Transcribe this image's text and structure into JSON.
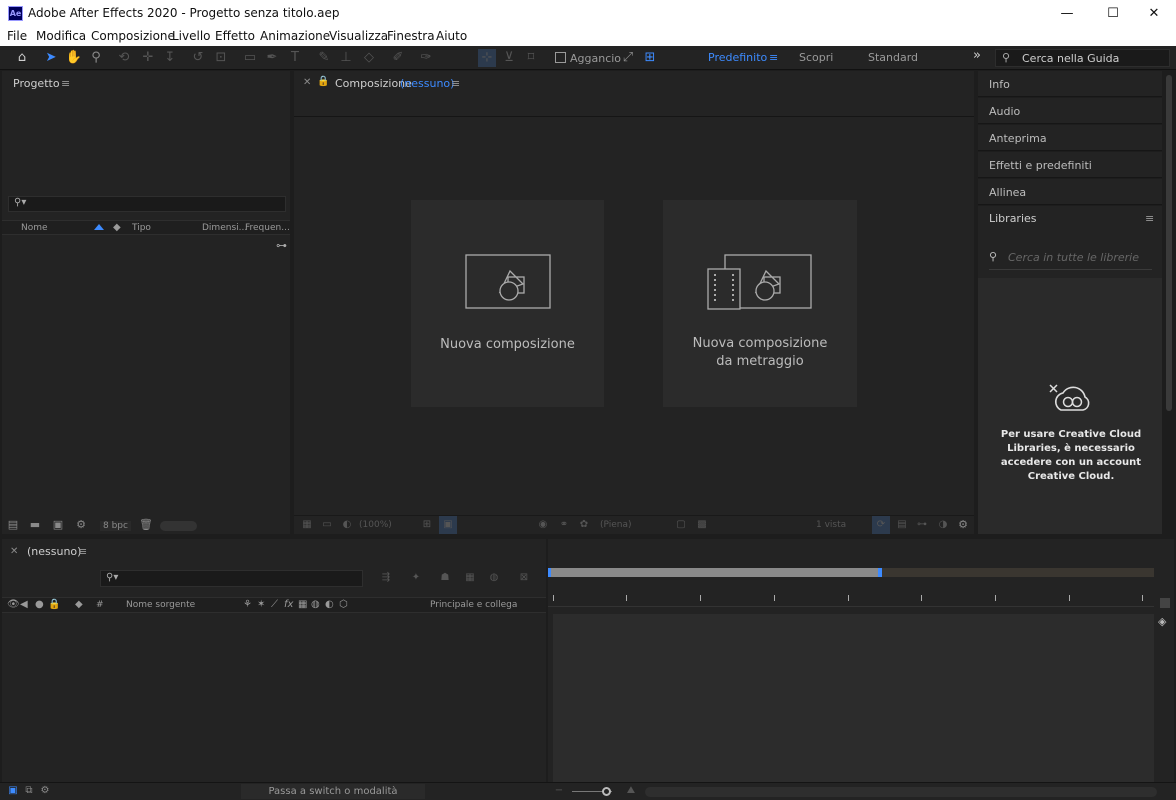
{
  "window": {
    "title": "Adobe After Effects 2020 - Progetto senza titolo.aep",
    "app_icon_text": "Ae",
    "minimize": "—",
    "maximize": "☐",
    "close": "✕"
  },
  "menu": [
    "File",
    "Modifica",
    "Composizione",
    "Livello",
    "Effetto",
    "Animazione",
    "Visualizza",
    "Finestra",
    "Aiuto"
  ],
  "toolbar": {
    "snap_label": "Aggancio",
    "workspaces": [
      "Predefinito",
      "Scopri",
      "Standard"
    ],
    "active_workspace": "Predefinito",
    "overflow": "»",
    "help_search_placeholder": "Cerca nella Guida"
  },
  "project_panel": {
    "title": "Progetto",
    "columns": [
      "Nome",
      "Tipo",
      "Dimensi...",
      "Frequen..."
    ],
    "bpc": "8 bpc"
  },
  "composition_panel": {
    "title": "Composizione",
    "subtitle": "(nessuno)",
    "new_comp_label": "Nuova composizione",
    "new_comp_footage_line1": "Nuova composizione",
    "new_comp_footage_line2": "da metraggio",
    "zoom": "(100%)",
    "resolution": "(Piena)",
    "views": "1 vista"
  },
  "right_panels": {
    "items": [
      "Info",
      "Audio",
      "Anteprima",
      "Effetti e predefiniti",
      "Allinea"
    ],
    "libraries_title": "Libraries",
    "libraries_search_placeholder": "Cerca in tutte le librerie",
    "cc_message": "Per usare Creative Cloud Libraries, è necessario accedere con un account Creative Cloud."
  },
  "timeline": {
    "title": "(nessuno)",
    "col_hash": "#",
    "col_source": "Nome sorgente",
    "col_parent": "Principale e collega",
    "fx_label": "fx"
  },
  "statusbar": {
    "toggle_label": "Passa a switch o modalità"
  },
  "colors": {
    "accent": "#3d8bff",
    "panel_bg": "#232323",
    "app_bg": "#1d1d1d"
  }
}
